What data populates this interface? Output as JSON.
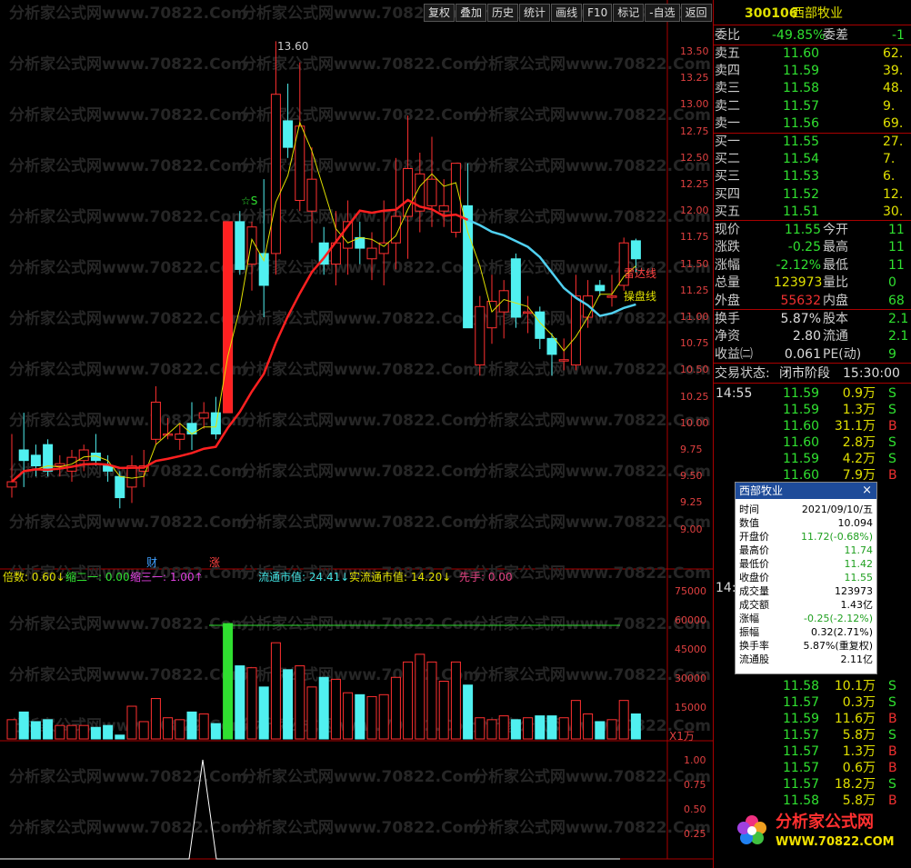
{
  "toolbar": [
    "复权",
    "叠加",
    "历史",
    "统计",
    "画线",
    "F10",
    "标记",
    "-自选",
    "返回"
  ],
  "watermark": "分析家公式网www.70822.Com",
  "price_axis": [
    "13.50",
    "13.25",
    "13.00",
    "12.75",
    "12.50",
    "12.25",
    "12.00",
    "11.75",
    "11.50",
    "11.25",
    "11.00",
    "10.75",
    "10.50",
    "10.25",
    "10.00",
    "9.75",
    "9.50",
    "9.25",
    "9.00"
  ],
  "vol_axis": [
    "75000",
    "60000",
    "45000",
    "30000",
    "15000"
  ],
  "vol_unit": "X1万",
  "ind_axis": [
    "1.00",
    "0.75",
    "0.50",
    "0.25"
  ],
  "high_label": "13.60",
  "chart_labels": {
    "leida": "雷达线",
    "caopan": "操盘线",
    "cai": "财",
    "zhang": "涨",
    "star": "☆S"
  },
  "indicators": [
    {
      "text": "倍数: 0.60↓",
      "color": "#e0e000"
    },
    {
      "text": "缩二一: 0.00",
      "color": "#30e030"
    },
    {
      "text": "缩三一: 1.00↑",
      "color": "#e040e0"
    },
    {
      "text": "流通市值: 24.41↓",
      "color": "#40e0e0"
    },
    {
      "text": "实流通市值: 14.20↓",
      "color": "#e0e000"
    },
    {
      "text": "先手: 0.00",
      "color": "#e04080"
    }
  ],
  "stock": {
    "code": "300106",
    "name": "西部牧业"
  },
  "weibi": {
    "label": "委比",
    "value": "-49.85%",
    "label2": "委差",
    "value2": "-1"
  },
  "asks": [
    {
      "label": "卖五",
      "price": "11.60",
      "vol": "62."
    },
    {
      "label": "卖四",
      "price": "11.59",
      "vol": "39."
    },
    {
      "label": "卖三",
      "price": "11.58",
      "vol": "48."
    },
    {
      "label": "卖二",
      "price": "11.57",
      "vol": "9."
    },
    {
      "label": "卖一",
      "price": "11.56",
      "vol": "69."
    }
  ],
  "bids": [
    {
      "label": "买一",
      "price": "11.55",
      "vol": "27."
    },
    {
      "label": "买二",
      "price": "11.54",
      "vol": "7."
    },
    {
      "label": "买三",
      "price": "11.53",
      "vol": "6."
    },
    {
      "label": "买四",
      "price": "11.52",
      "vol": "12."
    },
    {
      "label": "买五",
      "price": "11.51",
      "vol": "30."
    }
  ],
  "quote": [
    {
      "k": "现价",
      "v": "11.55",
      "k2": "今开",
      "v2": "11"
    },
    {
      "k": "涨跌",
      "v": "-0.25",
      "k2": "最高",
      "v2": "11"
    },
    {
      "k": "涨幅",
      "v": "-2.12%",
      "k2": "最低",
      "v2": "11"
    },
    {
      "k": "总量",
      "v": "123973",
      "k2": "量比",
      "v2": "0"
    },
    {
      "k": "外盘",
      "v": "55632",
      "k2": "内盘",
      "v2": "68"
    }
  ],
  "quote2": [
    {
      "k": "换手",
      "v": "5.87%",
      "k2": "股本",
      "v2": "2.1"
    },
    {
      "k": "净资",
      "v": "2.80",
      "k2": "流通",
      "v2": "2.1"
    },
    {
      "k": "收益㈡",
      "v": "0.061",
      "k2": "PE(动)",
      "v2": "9"
    }
  ],
  "status": {
    "label": "交易状态:",
    "value": "闭市阶段",
    "time": "15:30:00"
  },
  "ticks_time": "14:55",
  "ticks": [
    {
      "p": "11.59",
      "v": "0.9万",
      "d": "S"
    },
    {
      "p": "11.59",
      "v": "1.3万",
      "d": "S"
    },
    {
      "p": "11.60",
      "v": "31.1万",
      "d": "B"
    },
    {
      "p": "11.60",
      "v": "2.8万",
      "d": "S"
    },
    {
      "p": "11.59",
      "v": "4.2万",
      "d": "S"
    },
    {
      "p": "11.60",
      "v": "7.9万",
      "d": "B"
    }
  ],
  "ticks2_time": "14:5",
  "ticks2": [
    {
      "p": "11.58",
      "v": "10.1万",
      "d": "S"
    },
    {
      "p": "11.57",
      "v": "0.3万",
      "d": "S"
    },
    {
      "p": "11.59",
      "v": "11.6万",
      "d": "B"
    },
    {
      "p": "11.57",
      "v": "5.8万",
      "d": "S"
    },
    {
      "p": "11.57",
      "v": "1.3万",
      "d": "B"
    },
    {
      "p": "11.57",
      "v": "0.6万",
      "d": "B"
    },
    {
      "p": "11.57",
      "v": "18.2万",
      "d": "S"
    },
    {
      "p": "11.58",
      "v": "5.8万",
      "d": "B"
    }
  ],
  "popup": {
    "title": "西部牧业",
    "rows": [
      {
        "k": "时间",
        "v": "2021/09/10/五",
        "c": "#000"
      },
      {
        "k": "数值",
        "v": "10.094",
        "c": "#000"
      },
      {
        "k": "开盘价",
        "v": "11.72(-0.68%)",
        "c": "#20a020"
      },
      {
        "k": "最高价",
        "v": "11.74",
        "c": "#20a020"
      },
      {
        "k": "最低价",
        "v": "11.42",
        "c": "#20a020"
      },
      {
        "k": "收盘价",
        "v": "11.55",
        "c": "#20a020"
      },
      {
        "k": "成交量",
        "v": "123973",
        "c": "#000"
      },
      {
        "k": "成交额",
        "v": "1.43亿",
        "c": "#000"
      },
      {
        "k": "涨幅",
        "v": "-0.25(-2.12%)",
        "c": "#20a020"
      },
      {
        "k": "振幅",
        "v": "0.32(2.71%)",
        "c": "#000"
      },
      {
        "k": "换手率",
        "v": "5.87%(重复权)",
        "c": "#000"
      },
      {
        "k": "流通股",
        "v": "2.11亿",
        "c": "#000"
      }
    ]
  },
  "logo": {
    "text": "分析家公式网",
    "url": "WWW.70822.COM"
  },
  "chart_data": {
    "type": "candlestick",
    "series": [
      {
        "o": 9.4,
        "h": 9.9,
        "l": 9.3,
        "c": 9.45
      },
      {
        "o": 9.75,
        "h": 10.1,
        "l": 9.4,
        "c": 9.65
      },
      {
        "o": 9.7,
        "h": 9.8,
        "l": 9.5,
        "c": 9.6
      },
      {
        "o": 9.8,
        "h": 9.85,
        "l": 9.5,
        "c": 9.55
      },
      {
        "o": 9.6,
        "h": 9.7,
        "l": 9.5,
        "c": 9.62
      },
      {
        "o": 9.55,
        "h": 9.75,
        "l": 9.45,
        "c": 9.68
      },
      {
        "o": 9.65,
        "h": 9.8,
        "l": 9.55,
        "c": 9.75
      },
      {
        "o": 9.72,
        "h": 9.9,
        "l": 9.6,
        "c": 9.65
      },
      {
        "o": 9.6,
        "h": 9.7,
        "l": 9.45,
        "c": 9.55
      },
      {
        "o": 9.5,
        "h": 9.55,
        "l": 9.2,
        "c": 9.3
      },
      {
        "o": 9.4,
        "h": 9.7,
        "l": 9.25,
        "c": 9.6
      },
      {
        "o": 9.55,
        "h": 9.75,
        "l": 9.4,
        "c": 9.6
      },
      {
        "o": 9.85,
        "h": 10.35,
        "l": 9.8,
        "c": 10.2
      },
      {
        "o": 9.9,
        "h": 10.05,
        "l": 9.85,
        "c": 9.9
      },
      {
        "o": 9.85,
        "h": 10.0,
        "l": 9.75,
        "c": 9.9
      },
      {
        "o": 10.0,
        "h": 10.2,
        "l": 9.75,
        "c": 9.9
      },
      {
        "o": 10.05,
        "h": 10.2,
        "l": 9.95,
        "c": 10.1
      },
      {
        "o": 10.1,
        "h": 10.25,
        "l": 9.85,
        "c": 9.9
      },
      {
        "o": 10.1,
        "h": 11.9,
        "l": 10.1,
        "c": 11.9
      },
      {
        "o": 11.9,
        "h": 12.0,
        "l": 11.4,
        "c": 11.45
      },
      {
        "o": 11.5,
        "h": 11.9,
        "l": 11.25,
        "c": 11.85
      },
      {
        "o": 11.6,
        "h": 12.3,
        "l": 11.0,
        "c": 11.3
      },
      {
        "o": 11.6,
        "h": 13.6,
        "l": 11.4,
        "c": 13.1
      },
      {
        "o": 12.85,
        "h": 13.2,
        "l": 12.5,
        "c": 12.6
      },
      {
        "o": 12.1,
        "h": 13.4,
        "l": 12.0,
        "c": 12.8
      },
      {
        "o": 12.0,
        "h": 12.6,
        "l": 11.7,
        "c": 12.3
      },
      {
        "o": 11.7,
        "h": 11.85,
        "l": 11.4,
        "c": 11.5
      },
      {
        "o": 11.5,
        "h": 12.0,
        "l": 11.3,
        "c": 11.7
      },
      {
        "o": 11.65,
        "h": 12.1,
        "l": 11.4,
        "c": 11.9
      },
      {
        "o": 11.75,
        "h": 11.9,
        "l": 11.5,
        "c": 11.65
      },
      {
        "o": 11.55,
        "h": 11.8,
        "l": 11.35,
        "c": 11.65
      },
      {
        "o": 11.6,
        "h": 12.1,
        "l": 11.3,
        "c": 11.7
      },
      {
        "o": 11.7,
        "h": 12.5,
        "l": 11.45,
        "c": 11.95
      },
      {
        "o": 11.95,
        "h": 12.9,
        "l": 11.55,
        "c": 12.4
      },
      {
        "o": 12.0,
        "h": 12.55,
        "l": 11.8,
        "c": 12.35
      },
      {
        "o": 12.05,
        "h": 12.7,
        "l": 11.85,
        "c": 12.3
      },
      {
        "o": 12.0,
        "h": 12.3,
        "l": 11.85,
        "c": 12.05
      },
      {
        "o": 11.8,
        "h": 12.45,
        "l": 11.75,
        "c": 12.45
      },
      {
        "o": 12.05,
        "h": 12.45,
        "l": 11.0,
        "c": 10.9
      },
      {
        "o": 10.55,
        "h": 11.2,
        "l": 10.45,
        "c": 11.1
      },
      {
        "o": 10.9,
        "h": 11.4,
        "l": 10.75,
        "c": 11.15
      },
      {
        "o": 11.05,
        "h": 11.35,
        "l": 10.8,
        "c": 11.25
      },
      {
        "o": 11.55,
        "h": 11.6,
        "l": 10.9,
        "c": 11.0
      },
      {
        "o": 11.05,
        "h": 11.2,
        "l": 10.85,
        "c": 11.05
      },
      {
        "o": 11.05,
        "h": 11.1,
        "l": 10.7,
        "c": 10.8
      },
      {
        "o": 10.8,
        "h": 10.85,
        "l": 10.45,
        "c": 10.65
      },
      {
        "o": 10.6,
        "h": 10.8,
        "l": 10.5,
        "c": 10.6
      },
      {
        "o": 10.55,
        "h": 11.4,
        "l": 10.5,
        "c": 11.2
      },
      {
        "o": 11.0,
        "h": 11.35,
        "l": 10.9,
        "c": 11.2
      },
      {
        "o": 11.3,
        "h": 11.35,
        "l": 11.2,
        "c": 11.25
      },
      {
        "o": 11.2,
        "h": 11.4,
        "l": 11.1,
        "c": 11.2
      },
      {
        "o": 11.3,
        "h": 11.75,
        "l": 11.25,
        "c": 11.7
      },
      {
        "o": 11.72,
        "h": 11.74,
        "l": 11.42,
        "c": 11.55
      }
    ],
    "price_range": [
      9.0,
      13.6
    ],
    "volume": [
      10,
      14,
      9,
      10,
      7,
      7,
      7,
      6,
      7,
      2,
      17,
      9,
      21,
      11,
      10,
      14,
      13,
      8,
      60,
      38,
      37,
      27,
      50,
      36,
      38,
      27,
      32,
      31,
      24,
      23,
      22,
      23,
      32,
      40,
      44,
      40,
      30,
      40,
      28,
      11,
      10,
      12,
      10,
      11,
      12,
      12,
      11,
      20,
      13,
      9,
      10,
      20,
      13
    ],
    "vol_range": [
      0,
      75000
    ],
    "grid": false
  }
}
